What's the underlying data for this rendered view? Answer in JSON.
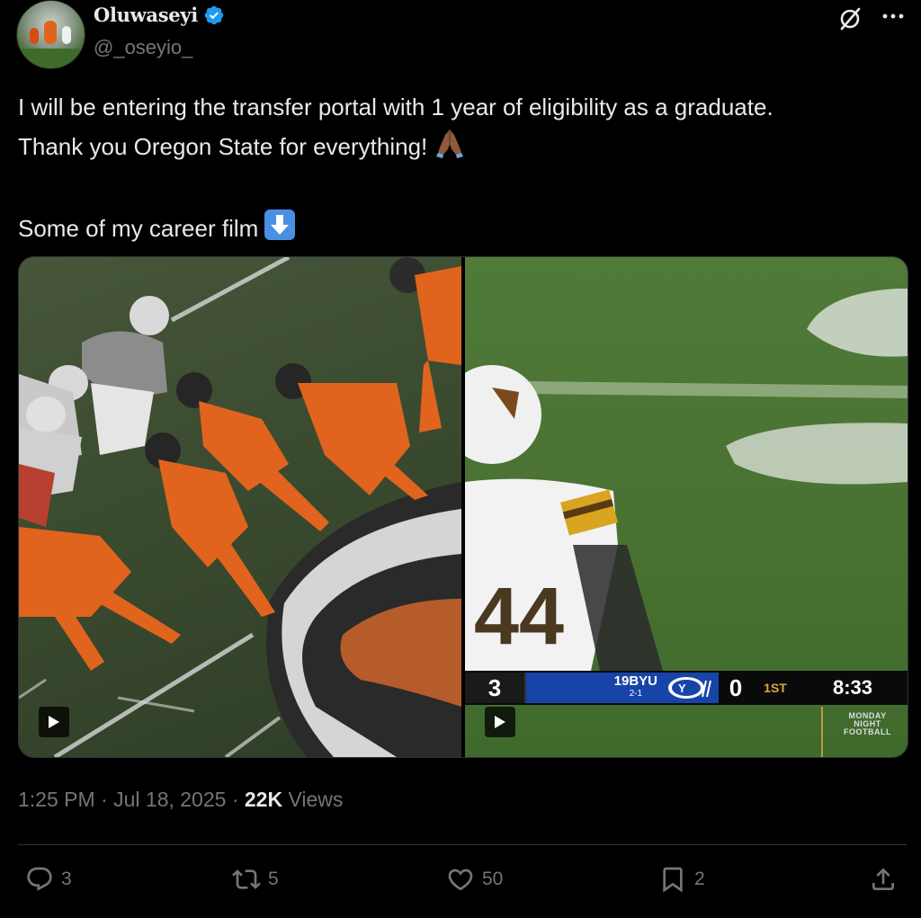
{
  "author": {
    "display_name": "Oluwaseyi",
    "handle": "@_oseyio_"
  },
  "tweet": {
    "lines": [
      "I will be entering the transfer portal with 1 year of eligibility as a graduate.",
      "Thank you Oregon State for everything!",
      "Some of my career film"
    ],
    "emoji_icons": [
      "folded-hands-icon",
      "down-arrow-icon"
    ]
  },
  "media": {
    "scorebug": {
      "left_score": "3",
      "team_rank": "19",
      "team_name": "BYU",
      "team_record": "2-1",
      "right_score": "0",
      "quarter": "1ST",
      "clock": "8:33",
      "network_line1": "MONDAY",
      "network_line2": "NIGHT",
      "network_line3": "FOOTBALL"
    }
  },
  "meta": {
    "time": "1:25 PM",
    "separator": "·",
    "date": "Jul 18, 2025",
    "views_count": "22K",
    "views_label": "Views"
  },
  "actions": {
    "replies": "3",
    "reposts": "5",
    "likes": "50",
    "bookmarks": "2"
  },
  "colors": {
    "background": "#000000",
    "text": "#e7e9ea",
    "muted": "#71767b",
    "verified": "#1d9bf0",
    "byu_blue": "#1744a8"
  }
}
